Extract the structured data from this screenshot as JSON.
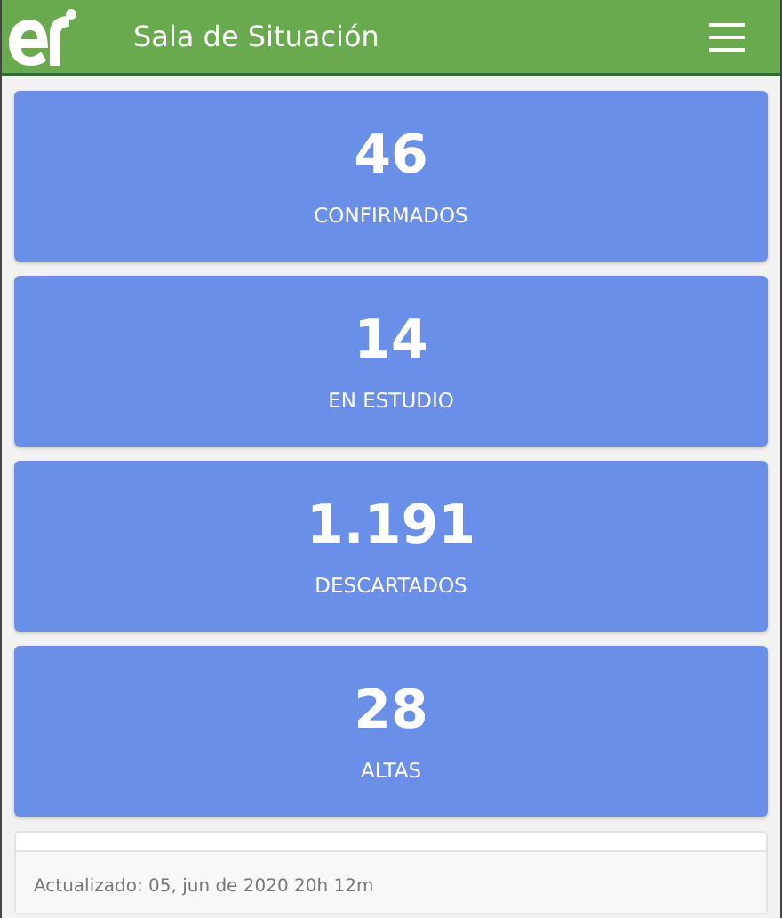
{
  "header": {
    "title": "Sala de Situación"
  },
  "stats": [
    {
      "value": "46",
      "label": "CONFIRMADOS"
    },
    {
      "value": "14",
      "label": "EN ESTUDIO"
    },
    {
      "value": "1.191",
      "label": "DESCARTADOS"
    },
    {
      "value": "28",
      "label": "ALTAS"
    }
  ],
  "footer": {
    "updated": "Actualizado: 05, jun de 2020 20h 12m"
  }
}
